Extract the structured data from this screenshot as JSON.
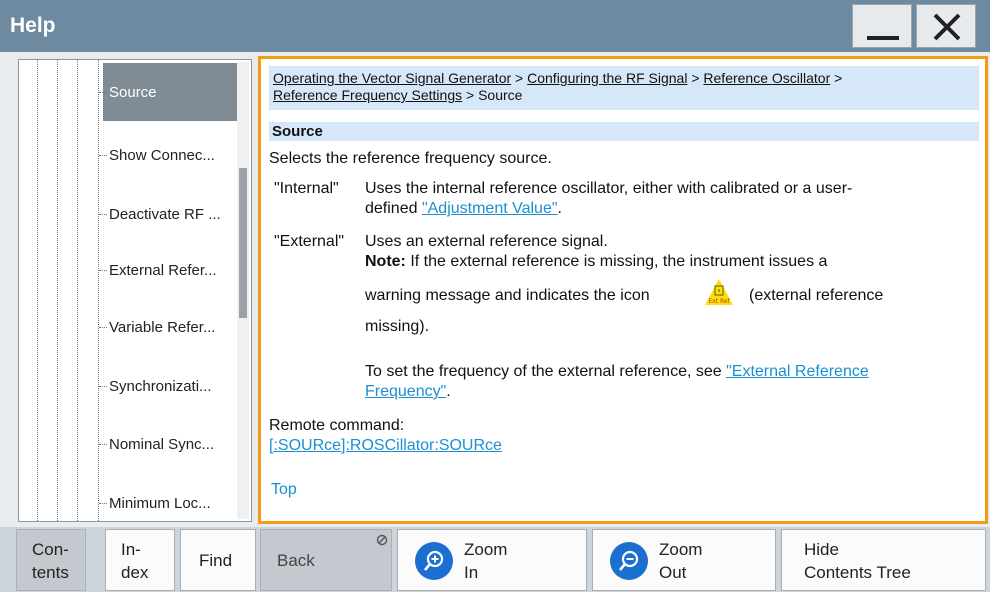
{
  "window": {
    "title": "Help"
  },
  "titlebar": {
    "minimize_icon": "minimize-icon",
    "close_icon": "close-icon"
  },
  "tree": {
    "items": [
      {
        "label": "Source",
        "selected": true
      },
      {
        "label": "Show Connec...",
        "selected": false
      },
      {
        "label": "Deactivate RF ...",
        "selected": false
      },
      {
        "label": "External Refer...",
        "selected": false
      },
      {
        "label": "Variable Refer...",
        "selected": false
      },
      {
        "label": "Synchronizati...",
        "selected": false
      },
      {
        "label": "Nominal Sync...",
        "selected": false
      },
      {
        "label": "Minimum Loc...",
        "selected": false
      }
    ]
  },
  "help": {
    "breadcrumb": {
      "part1": "Operating the Vector Signal Generator",
      "sep": " > ",
      "part2": "Configuring the RF Signal",
      "part3": "Reference Oscillator",
      "part4": "Reference Frequency Settings",
      "current": "Source"
    },
    "section_title": "Source",
    "description": "Selects the reference frequency source.",
    "internal": {
      "key": "\"Internal\"",
      "line1": "Uses the internal reference oscillator, either with calibrated or a user-",
      "line2_prefix": "defined ",
      "link": "\"Adjustment Value\"",
      "line2_suffix": "."
    },
    "external": {
      "key": "\"External\"",
      "line1": "Uses an external reference signal.",
      "note_label": "Note:",
      "note_text": " If the external reference is missing, the instrument issues a",
      "warn_prefix": "warning message and indicates the icon",
      "warn_suffix": "(external reference",
      "warn_end": "missing).",
      "icon_text": "Ext Ref",
      "set_text": "To set the frequency of the external reference, see ",
      "set_link1": "\"External Reference",
      "set_link2": "Frequency\"",
      "set_end": "."
    },
    "remote_label": "Remote command:",
    "remote_command": "[:SOURce]:ROSCillator:SOURce",
    "top_link": "Top"
  },
  "toolbar": {
    "contents": {
      "l1": "Con-",
      "l2": "tents"
    },
    "index": {
      "l1": "In-",
      "l2": "dex"
    },
    "find": "Find",
    "back": "Back",
    "zoom_in": {
      "l1": "Zoom",
      "l2": "In"
    },
    "zoom_out": {
      "l1": "Zoom",
      "l2": "Out"
    },
    "hide": {
      "l1": "Hide",
      "l2": "Contents Tree"
    }
  },
  "colors": {
    "accent_border": "#f39b17",
    "link": "#1c8fd0",
    "titlebar": "#6e8aa0",
    "zoom_icon": "#1a6fd0"
  }
}
